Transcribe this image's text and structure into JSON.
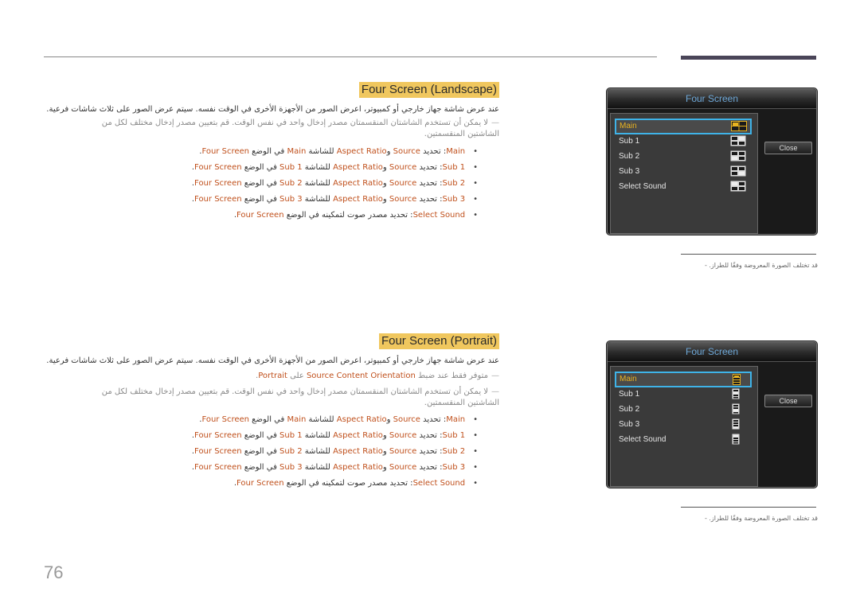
{
  "page_number": "76",
  "sections": [
    {
      "title": "Four Screen (Landscape)",
      "intro": "عند عرض شاشة جهاز خارجي أو كمبيوتر، اعرض الصور من الأجهزة الأخرى في الوقت نفسه. سيتم عرض الصور على ثلاث شاشات فرعية.",
      "notes": [
        "لا يمكن أن تستخدم الشاشتان المنقسمتان مصدر إدخال واحد في نفس الوقت. قم بتعيين مصدر إدخال مختلف لكل من الشاشتين المنقسمتين."
      ],
      "bullets": [
        {
          "key": "Main",
          "text_a": ": تحديد ",
          "src": "Source",
          "and": " و",
          "ar": "Aspect Ratio",
          "text_b": " للشاشة ",
          "scr": "Main",
          "text_c": " في الوضع ",
          "mode": "Four Screen",
          "end": "."
        },
        {
          "key": "Sub 1",
          "text_a": ": تحديد ",
          "src": "Source",
          "and": " و",
          "ar": "Aspect Ratio",
          "text_b": " للشاشة ",
          "scr": "Sub 1",
          "text_c": " في الوضع ",
          "mode": "Four Screen",
          "end": "."
        },
        {
          "key": "Sub 2",
          "text_a": ": تحديد ",
          "src": "Source",
          "and": " و",
          "ar": "Aspect Ratio",
          "text_b": " للشاشة ",
          "scr": "Sub 2",
          "text_c": " في الوضع ",
          "mode": "Four Screen",
          "end": "."
        },
        {
          "key": "Sub 3",
          "text_a": ": تحديد ",
          "src": "Source",
          "and": " و",
          "ar": "Aspect Ratio",
          "text_b": " للشاشة ",
          "scr": "Sub 3",
          "text_c": " في الوضع ",
          "mode": "Four Screen",
          "end": "."
        }
      ],
      "sound_bullet": {
        "key": "Select Sound",
        "text": ": تحديد مصدر صوت لتمكينه في الوضع ",
        "mode": "Four Screen",
        "end": "."
      },
      "osd": {
        "title": "Four Screen",
        "items": [
          "Main",
          "Sub 1",
          "Sub 2",
          "Sub 3",
          "Select Sound"
        ],
        "selected": "Main",
        "close_label": "Close",
        "layout_icon_type": "quad-grid"
      },
      "side_note": "قد تختلف الصورة المعروضة وفقًا للطراز."
    },
    {
      "title": "Four Screen (Portrait)",
      "intro": "عند عرض شاشة جهاز خارجي أو كمبيوتر، اعرض الصور من الأجهزة الأخرى في الوقت نفسه. سيتم عرض الصور على ثلاث شاشات فرعية.",
      "portrait_note": {
        "pre": "متوفر فقط عند ضبط ",
        "opt": "Source Content Orientation",
        "mid": " على ",
        "val": "Portrait",
        "end": "."
      },
      "notes": [
        "لا يمكن أن تستخدم الشاشتان المنقسمتان مصدر إدخال واحد في نفس الوقت. قم بتعيين مصدر إدخال مختلف لكل من الشاشتين المنقسمتين."
      ],
      "bullets": [
        {
          "key": "Main",
          "text_a": ": تحديد ",
          "src": "Source",
          "and": " و",
          "ar": "Aspect Ratio",
          "text_b": " للشاشة ",
          "scr": "Main",
          "text_c": " في الوضع ",
          "mode": "Four Screen",
          "end": "."
        },
        {
          "key": "Sub 1",
          "text_a": ": تحديد ",
          "src": "Source",
          "and": " و",
          "ar": "Aspect Ratio",
          "text_b": " للشاشة ",
          "scr": "Sub 1",
          "text_c": " في الوضع ",
          "mode": "Four Screen",
          "end": "."
        },
        {
          "key": "Sub 2",
          "text_a": ": تحديد ",
          "src": "Source",
          "and": " و",
          "ar": "Aspect Ratio",
          "text_b": " للشاشة ",
          "scr": "Sub 2",
          "text_c": " في الوضع ",
          "mode": "Four Screen",
          "end": "."
        },
        {
          "key": "Sub 3",
          "text_a": ": تحديد ",
          "src": "Source",
          "and": " و",
          "ar": "Aspect Ratio",
          "text_b": " للشاشة ",
          "scr": "Sub 3",
          "text_c": " في الوضع ",
          "mode": "Four Screen",
          "end": "."
        }
      ],
      "sound_bullet": {
        "key": "Select Sound",
        "text": ": تحديد مصدر صوت لتمكينه في الوضع ",
        "mode": "Four Screen",
        "end": "."
      },
      "osd": {
        "title": "Four Screen",
        "items": [
          "Main",
          "Sub 1",
          "Sub 2",
          "Sub 3",
          "Select Sound"
        ],
        "selected": "Main",
        "close_label": "Close",
        "layout_icon_type": "vertical-stack"
      },
      "side_note": "قد تختلف الصورة المعروضة وفقًا للطراز."
    }
  ],
  "colors": {
    "title_highlight": "#f0c75e",
    "keyword": "#c0501c",
    "osd_title": "#6ea8d8",
    "osd_selected_text": "#e8b321",
    "osd_selected_border": "#3fb3e8",
    "header_bar": "#4a4558"
  }
}
